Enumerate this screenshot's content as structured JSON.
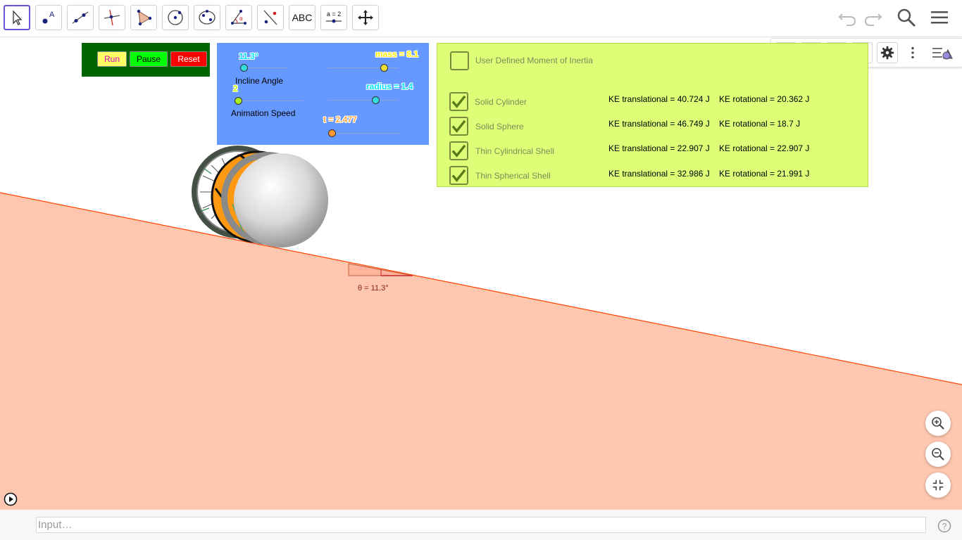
{
  "toolbar": {
    "tools": [
      {
        "name": "move-tool-icon"
      },
      {
        "name": "point-tool-icon",
        "label": "A"
      },
      {
        "name": "line-tool-icon"
      },
      {
        "name": "perpendicular-line-tool-icon"
      },
      {
        "name": "polygon-tool-icon"
      },
      {
        "name": "circle-tool-icon"
      },
      {
        "name": "conic-tool-icon"
      },
      {
        "name": "angle-tool-icon",
        "label": "α"
      },
      {
        "name": "reflect-tool-icon"
      },
      {
        "name": "text-tool-icon",
        "label": "ABC"
      },
      {
        "name": "slider-tool-icon",
        "label": "a = 2"
      },
      {
        "name": "move-graphics-view-icon"
      }
    ],
    "right": [
      "undo-icon",
      "redo-icon",
      "search-icon",
      "menu-icon"
    ]
  },
  "style_bar": [
    "axes-icon",
    "grid-icon",
    "home-icon",
    "point-capturing-icon",
    "settings-icon",
    "more-icon",
    "style-bar-toggle-icon"
  ],
  "controls": {
    "run": "Run",
    "pause": "Pause",
    "reset": "Reset",
    "colors": {
      "panel": "#006400",
      "run": "#ffff66",
      "run_text": "#cc00cc",
      "pause": "#00ff00",
      "reset": "#ff0000"
    }
  },
  "sliders": {
    "incline_value": "11.3°",
    "incline_label": "Incline Angle",
    "speed_value": "2",
    "speed_label": "Animation Speed",
    "mass_value": "mass = 8.1",
    "radius_value": "radius = 1.4",
    "t_value": "t = 2.477"
  },
  "inertia": {
    "user_defined_label": "User Defined Moment of Inertia",
    "user_defined_checked": false,
    "objects": [
      {
        "label": "Solid Cylinder",
        "checked": true,
        "ke_trans": "KE translational = 40.724 J",
        "ke_rot": "KE rotational = 20.362 J"
      },
      {
        "label": "Solid Sphere",
        "checked": true,
        "ke_trans": "KE translational = 46.749 J",
        "ke_rot": "KE rotational = 18.7 J"
      },
      {
        "label": "Thin Cylindrical Shell",
        "checked": true,
        "ke_trans": "KE translational = 22.907 J",
        "ke_rot": "KE rotational = 22.907 J"
      },
      {
        "label": "Thin Spherical Shell",
        "checked": true,
        "ke_trans": "KE translational = 32.986 J",
        "ke_rot": "KE rotational = 21.991 J"
      }
    ]
  },
  "canvas": {
    "angle_label": "θ = 11.3°",
    "incline_color": "#ffc7b0",
    "incline_edge_color": "#ff4400"
  },
  "input": {
    "placeholder": "Input…"
  }
}
